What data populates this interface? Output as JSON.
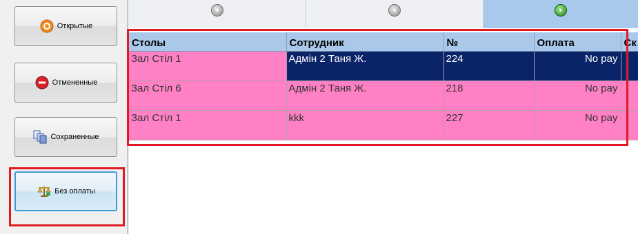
{
  "sidebar": {
    "buttons": [
      {
        "label": "Открытые",
        "icon": "orange-open-icon"
      },
      {
        "label": "Отмененные",
        "icon": "red-cancel-icon"
      },
      {
        "label": "Сохраненные",
        "icon": "stacked-pages-icon"
      },
      {
        "label": "Без оплаты",
        "icon": "scales-icon"
      }
    ]
  },
  "colors": {
    "row_pink": "#ff80c4",
    "row_selected": "#0a246a",
    "header_blue": "#aac8ea",
    "highlight_red": "#e01a22"
  },
  "table": {
    "columns": [
      "Столы",
      "Сотрудник",
      "№",
      "Оплата",
      "Ск"
    ],
    "rows": [
      {
        "table": "Зал Стіл 1",
        "employee": "Адмін 2 Таня Ж.",
        "number": "224",
        "payment": "No pay",
        "extra": ""
      },
      {
        "table": "Зал Стіл 6",
        "employee": "Адмін 2 Таня Ж.",
        "number": "218",
        "payment": "No pay",
        "extra": ""
      },
      {
        "table": "Зал Стіл 1",
        "employee": "kkk",
        "number": "227",
        "payment": "No pay",
        "extra": ""
      }
    ]
  }
}
